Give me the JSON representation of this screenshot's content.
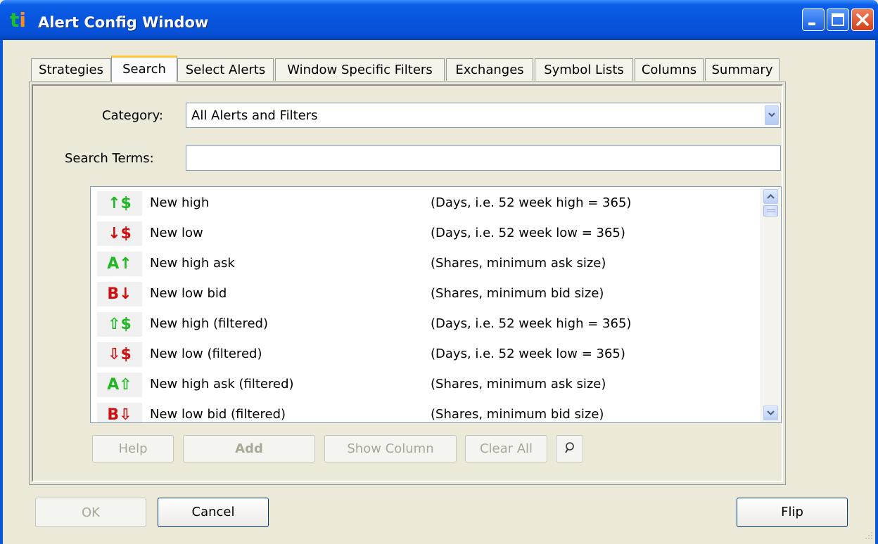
{
  "window": {
    "title": "Alert Config Window",
    "logo": {
      "t": "t",
      "i": "i"
    }
  },
  "tabs": [
    {
      "label": "Strategies",
      "active": false
    },
    {
      "label": "Search",
      "active": true
    },
    {
      "label": "Select Alerts",
      "active": false
    },
    {
      "label": "Window Specific Filters",
      "active": false
    },
    {
      "label": "Exchanges",
      "active": false
    },
    {
      "label": "Symbol Lists",
      "active": false
    },
    {
      "label": "Columns",
      "active": false
    },
    {
      "label": "Summary",
      "active": false
    }
  ],
  "search": {
    "category_label": "Category:",
    "category_value": "All Alerts and Filters",
    "terms_label": "Search Terms:",
    "terms_value": ""
  },
  "alerts": [
    {
      "glyph": "↑$",
      "color": "up",
      "name": "New high",
      "desc": "(Days, i.e. 52 week high = 365)"
    },
    {
      "glyph": "↓$",
      "color": "down",
      "name": "New low",
      "desc": "(Days, i.e. 52 week low = 365)"
    },
    {
      "glyph": "A↑",
      "color": "up",
      "name": "New high ask",
      "desc": "(Shares, minimum ask size)"
    },
    {
      "glyph": "B↓",
      "color": "down",
      "name": "New low bid",
      "desc": "(Shares, minimum bid size)"
    },
    {
      "glyph": "⇧$",
      "color": "up",
      "name": "New high (filtered)",
      "desc": "(Days, i.e. 52 week high = 365)"
    },
    {
      "glyph": "⇩$",
      "color": "down",
      "name": "New low (filtered)",
      "desc": "(Days, i.e. 52 week low = 365)"
    },
    {
      "glyph": "A⇧",
      "color": "up",
      "name": "New high ask (filtered)",
      "desc": "(Shares, minimum ask size)"
    },
    {
      "glyph": "B⇩",
      "color": "down",
      "name": "New low bid (filtered)",
      "desc": "(Shares, minimum bid size)"
    }
  ],
  "toolbar": {
    "help": "Help",
    "add": "Add",
    "show_column": "Show Column",
    "clear_all": "Clear All"
  },
  "footer": {
    "ok": "OK",
    "cancel": "Cancel",
    "flip": "Flip"
  },
  "colors": {
    "up": "#1FB820",
    "down": "#D01010",
    "title_bar": "#0855DD",
    "tab_highlight": "#FFC83C"
  }
}
